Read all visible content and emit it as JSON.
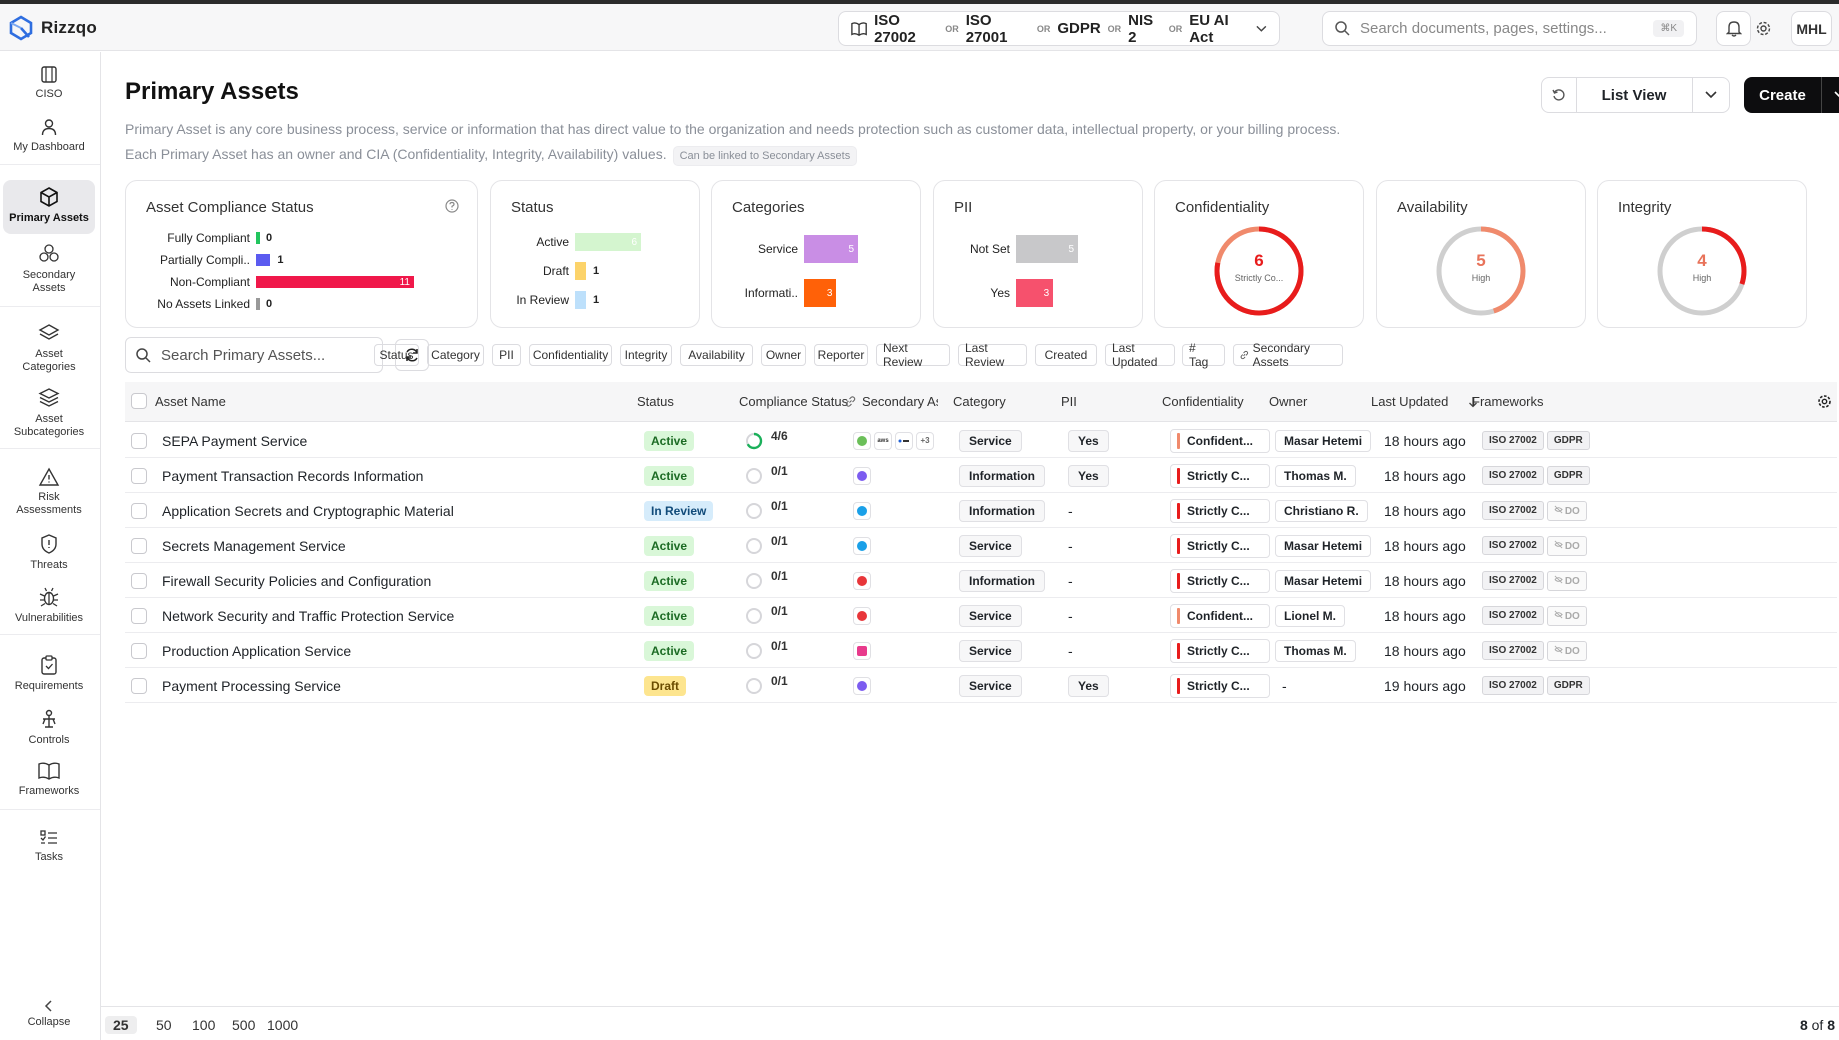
{
  "app": {
    "name": "Rizzqo"
  },
  "header": {
    "frameworks": [
      "ISO 27002",
      "ISO 27001",
      "GDPR",
      "NIS 2",
      "EU AI Act"
    ],
    "or_label": "OR",
    "search_placeholder": "Search documents, pages, settings...",
    "shortcut": "⌘K",
    "user_initials": "MHL"
  },
  "sidebar": {
    "items": [
      {
        "label": "CISO",
        "icon": "building-icon"
      },
      {
        "label": "My Dashboard",
        "icon": "user-icon"
      },
      {
        "label": "Primary Assets",
        "icon": "cube-icon",
        "active": true
      },
      {
        "label": "Secondary Assets",
        "icon": "cubes-icon"
      },
      {
        "label": "Asset Categories",
        "icon": "layers-icon"
      },
      {
        "label": "Asset Subcategories",
        "icon": "layers-stack-icon"
      },
      {
        "label": "Risk Assessments",
        "icon": "warning-icon"
      },
      {
        "label": "Threats",
        "icon": "shield-icon"
      },
      {
        "label": "Vulnerabilities",
        "icon": "bug-icon"
      },
      {
        "label": "Requirements",
        "icon": "clipboard-icon"
      },
      {
        "label": "Controls",
        "icon": "control-icon"
      },
      {
        "label": "Frameworks",
        "icon": "book-icon"
      },
      {
        "label": "Tasks",
        "icon": "tasks-icon"
      }
    ],
    "collapse_label": "Collapse"
  },
  "page": {
    "title": "Primary Assets",
    "description_1": "Primary Asset is any core business process, service or information that has direct value to the organization and needs protection such as customer data, intellectual property, or your billing process.",
    "description_2": "Each Primary Asset has an owner and CIA (Confidentiality, Integrity, Availability) values.",
    "note": "Can be linked to Secondary Assets",
    "view_label": "List View",
    "create_label": "Create"
  },
  "cards": {
    "compliance": {
      "title": "Asset Compliance Status",
      "rows": [
        {
          "label": "Fully Compliant",
          "value": 0,
          "color": "#22c55e"
        },
        {
          "label": "Partially Compli..",
          "value": 1,
          "color": "#5b5bf0"
        },
        {
          "label": "Non-Compliant",
          "value": 11,
          "color": "#f0184a"
        },
        {
          "label": "No Assets Linked",
          "value": 0,
          "color": "#999999"
        }
      ],
      "max": 11
    },
    "status": {
      "title": "Status",
      "rows": [
        {
          "label": "Active",
          "value": 6,
          "color": "#d4f5cf"
        },
        {
          "label": "Draft",
          "value": 1,
          "color": "#fcd36a"
        },
        {
          "label": "In Review",
          "value": 1,
          "color": "#bde0fb"
        }
      ],
      "max": 6
    },
    "categories": {
      "title": "Categories",
      "rows": [
        {
          "label": "Service",
          "value": 5,
          "color": "#c98ee5"
        },
        {
          "label": "Informati..",
          "value": 3,
          "color": "#ff6108"
        }
      ],
      "max": 5
    },
    "pii": {
      "title": "PII",
      "rows": [
        {
          "label": "Not Set",
          "value": 5,
          "color": "#c8c8ca"
        },
        {
          "label": "Yes",
          "value": 3,
          "color": "#f6516d"
        }
      ],
      "max": 5
    },
    "confidentiality": {
      "title": "Confidentiality",
      "value": "6",
      "sub": "Strictly Co...",
      "fraction": 0.78,
      "color": "#e81c1c",
      "color2": "#f08a6c"
    },
    "availability": {
      "title": "Availability",
      "value": "5",
      "sub": "High",
      "fraction": 0.45,
      "color": "#f08a6c",
      "color2": "#cfcfcf"
    },
    "integrity": {
      "title": "Integrity",
      "value": "4",
      "sub": "High",
      "fraction": 0.3,
      "color": "#e81c1c",
      "color2": "#cfcfcf"
    }
  },
  "filters": {
    "search_placeholder": "Search Primary Assets...",
    "chips": [
      "Status",
      "Category",
      "PII",
      "Confidentiality",
      "Integrity",
      "Availability",
      "Owner",
      "Reporter",
      "Next Review",
      "Last Review",
      "Created",
      "Last Updated",
      "# Tag",
      "Secondary Assets"
    ]
  },
  "table": {
    "columns": {
      "name": "Asset Name",
      "status": "Status",
      "compliance": "Compliance Status",
      "secondary": "Secondary Ass",
      "category": "Category",
      "pii": "PII",
      "confidentiality": "Confidentiality",
      "owner": "Owner",
      "updated": "Last Updated",
      "frameworks": "Frameworks"
    },
    "rows": [
      {
        "name": "SEPA Payment Service",
        "status": "Active",
        "compliance": "4/6",
        "compliance_frac": 0.67,
        "sec": [
          "green",
          "aws",
          "dots",
          "+3"
        ],
        "category": "Service",
        "pii": "Yes",
        "conf": "Confident...",
        "conf_color": "#f08a6c",
        "owner": "Masar Hetemi",
        "updated": "18 hours ago",
        "fw": [
          "ISO 27002",
          "GDPR"
        ]
      },
      {
        "name": "Payment Transaction Records Information",
        "status": "Active",
        "compliance": "0/1",
        "compliance_frac": 0,
        "sec": [
          "purple"
        ],
        "category": "Information",
        "pii": "Yes",
        "conf": "Strictly C...",
        "conf_color": "#e81c1c",
        "owner": "Thomas M.",
        "updated": "18 hours ago",
        "fw": [
          "ISO 27002",
          "GDPR"
        ]
      },
      {
        "name": "Application Secrets and Cryptographic Material",
        "status": "In Review",
        "compliance": "0/1",
        "compliance_frac": 0,
        "sec": [
          "blue"
        ],
        "category": "Information",
        "pii": "-",
        "conf": "Strictly C...",
        "conf_color": "#e81c1c",
        "owner": "Christiano R.",
        "updated": "18 hours ago",
        "fw": [
          "ISO 27002",
          "DO"
        ]
      },
      {
        "name": "Secrets Management Service",
        "status": "Active",
        "compliance": "0/1",
        "compliance_frac": 0,
        "sec": [
          "blue"
        ],
        "category": "Service",
        "pii": "-",
        "conf": "Strictly C...",
        "conf_color": "#e81c1c",
        "owner": "Masar Hetemi",
        "updated": "18 hours ago",
        "fw": [
          "ISO 27002",
          "DO"
        ]
      },
      {
        "name": "Firewall Security Policies and Configuration",
        "status": "Active",
        "compliance": "0/1",
        "compliance_frac": 0,
        "sec": [
          "red"
        ],
        "category": "Information",
        "pii": "-",
        "conf": "Strictly C...",
        "conf_color": "#e81c1c",
        "owner": "Masar Hetemi",
        "updated": "18 hours ago",
        "fw": [
          "ISO 27002",
          "DO"
        ]
      },
      {
        "name": "Network Security and Traffic Protection Service",
        "status": "Active",
        "compliance": "0/1",
        "compliance_frac": 0,
        "sec": [
          "red"
        ],
        "category": "Service",
        "pii": "-",
        "conf": "Confident...",
        "conf_color": "#f08a6c",
        "owner": "Lionel M.",
        "updated": "18 hours ago",
        "fw": [
          "ISO 27002",
          "DO"
        ]
      },
      {
        "name": "Production Application Service",
        "status": "Active",
        "compliance": "0/1",
        "compliance_frac": 0,
        "sec": [
          "pink"
        ],
        "category": "Service",
        "pii": "-",
        "conf": "Strictly C...",
        "conf_color": "#e81c1c",
        "owner": "Thomas M.",
        "updated": "18 hours ago",
        "fw": [
          "ISO 27002",
          "DO"
        ]
      },
      {
        "name": "Payment Processing Service",
        "status": "Draft",
        "compliance": "0/1",
        "compliance_frac": 0,
        "sec": [
          "purple"
        ],
        "category": "Service",
        "pii": "Yes",
        "conf": "Strictly C...",
        "conf_color": "#e81c1c",
        "owner": "-",
        "updated": "19 hours ago",
        "fw": [
          "ISO 27002",
          "GDPR"
        ]
      }
    ]
  },
  "pagination": {
    "sizes": [
      "25",
      "50",
      "100",
      "500",
      "1000"
    ],
    "count": "8",
    "of_label": "of",
    "total": "8"
  }
}
